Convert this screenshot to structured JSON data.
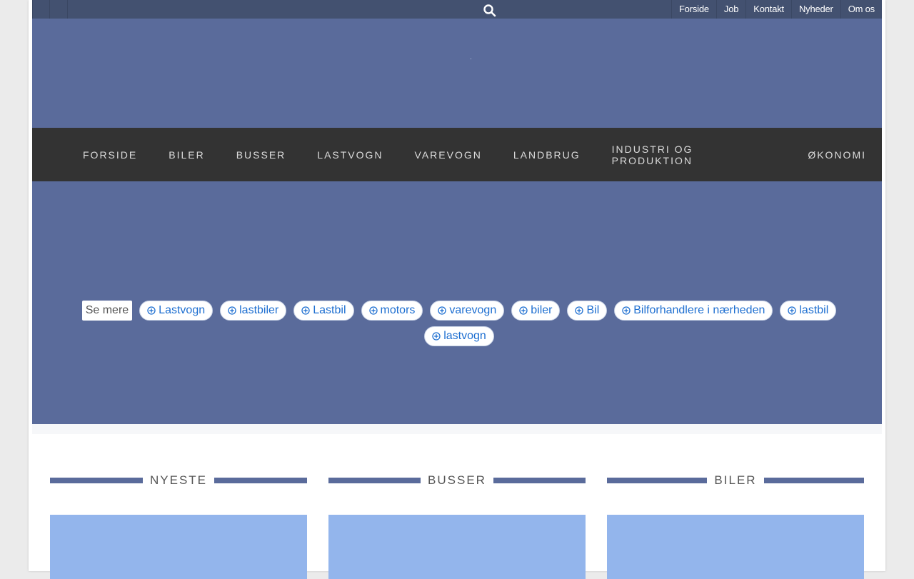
{
  "topbar": {
    "links": [
      "Forside",
      "Job",
      "Kontakt",
      "Nyheder",
      "Om os"
    ]
  },
  "mainnav": {
    "items": [
      "FORSIDE",
      "BILER",
      "BUSSER",
      "LASTVOGN",
      "VAREVOGN",
      "LANDBRUG",
      "INDUSTRI OG PRODUKTION",
      "ØKONOMI"
    ],
    "active": "FORSIDE"
  },
  "tags": {
    "lead": "Se mere",
    "items": [
      "Lastvogn",
      "lastbiler",
      "Lastbil",
      "motors",
      "varevogn",
      "biler",
      "Bil",
      "Bilforhandlere i nærheden",
      "lastbil",
      "lastvogn"
    ]
  },
  "columns": [
    {
      "title": "NYESTE"
    },
    {
      "title": "BUSSER"
    },
    {
      "title": "BILER"
    }
  ],
  "colors": {
    "topbar": "#435170",
    "header": "#5a6b9b",
    "nav": "#333333",
    "tag_text": "#1e6fd1",
    "thumb": "#93b5ec"
  }
}
